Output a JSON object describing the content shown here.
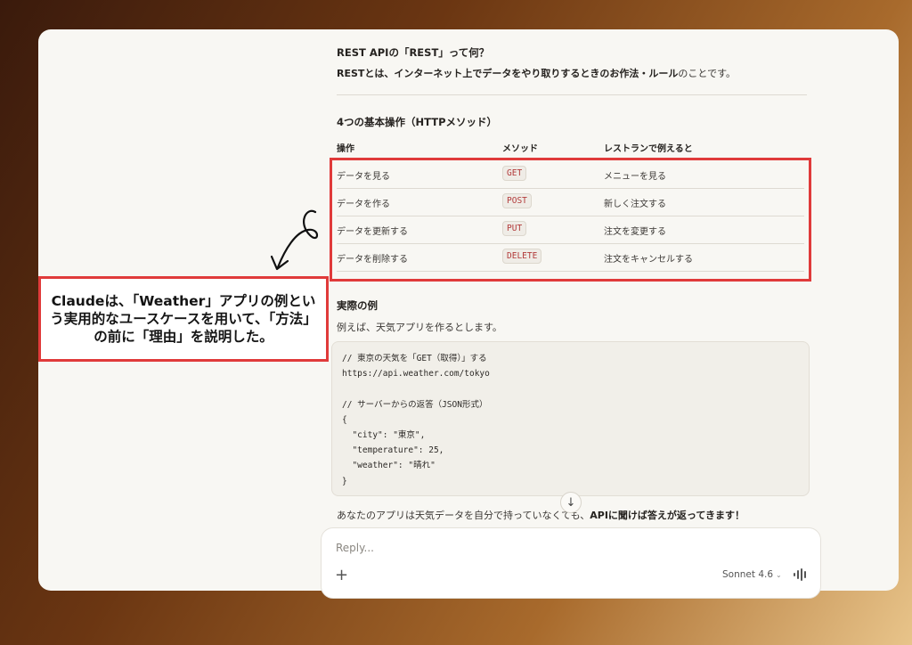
{
  "section1": {
    "title": "REST APIの「REST」って何？",
    "intro_prefix": "RESTとは、インターネット上でデータをやり取りするときの",
    "intro_bold": "お作法・ルール",
    "intro_suffix": "のことです。"
  },
  "section2": {
    "title": "4つの基本操作（HTTPメソッド）",
    "headers": [
      "操作",
      "メソッド",
      "レストランで例えると"
    ],
    "rows": [
      {
        "op": "データを見る",
        "method": "GET",
        "analogy": "メニューを見る"
      },
      {
        "op": "データを作る",
        "method": "POST",
        "analogy": "新しく注文する"
      },
      {
        "op": "データを更新する",
        "method": "PUT",
        "analogy": "注文を変更する"
      },
      {
        "op": "データを削除する",
        "method": "DELETE",
        "analogy": "注文をキャンセルする"
      }
    ]
  },
  "section3": {
    "title": "実際の例",
    "intro": "例えば、天気アプリを作るとします。",
    "code": "// 東京の天気を「GET（取得）」する\nhttps://api.weather.com/tokyo\n\n// サーバーからの返答（JSON形式）\n{\n  \"city\": \"東京\",\n  \"temperature\": 25,\n  \"weather\": \"晴れ\"\n}",
    "after_prefix": "あなたのアプリは天気データを自分で持っていなくても、",
    "after_bold": "APIに聞けば答えが返ってきます！"
  },
  "annotation": {
    "text": "Claudeは、「Weather」アプリの例という実用的なユースケースを用いて、「方法」の前に「理由」を説明した。"
  },
  "composer": {
    "placeholder": "Reply...",
    "model": "Sonnet 4.6",
    "plus_icon": "plus-icon",
    "voice_icon": "voice-waveform-icon"
  },
  "colors": {
    "accent_red": "#e03a3a",
    "code_red": "#b23a3a"
  }
}
